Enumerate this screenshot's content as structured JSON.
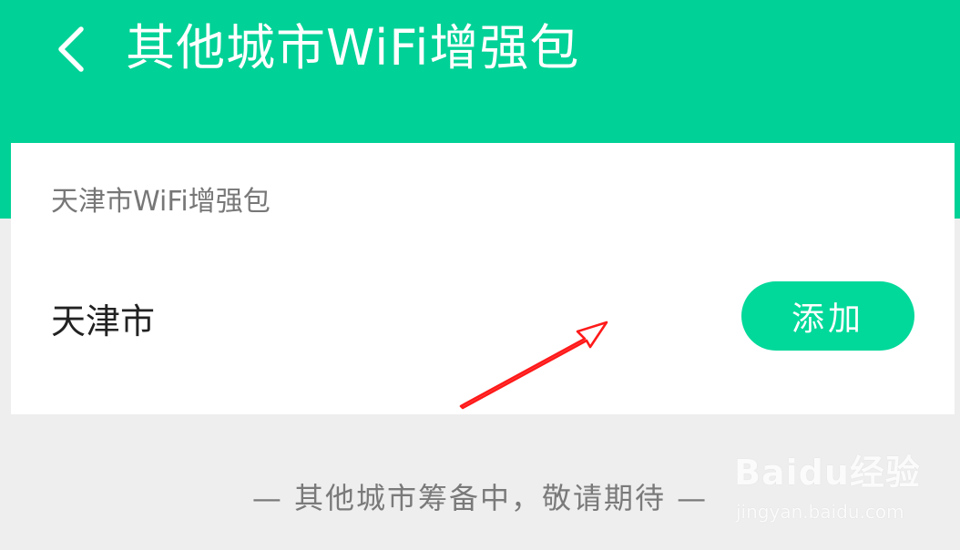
{
  "header": {
    "title": "其他城市WiFi增强包",
    "back_icon": "chevron-left-icon",
    "background_color": "#00d196"
  },
  "card": {
    "title": "天津市WiFi增强包",
    "item": {
      "city": "天津市",
      "add_label": "添加"
    }
  },
  "footer": {
    "message": "— 其他城市筹备中，敬请期待 —"
  },
  "watermark": {
    "brand": "Baidu经验",
    "url": "jingyan.baidu.com"
  },
  "annotation": {
    "arrow_color": "#ff1a1a"
  }
}
